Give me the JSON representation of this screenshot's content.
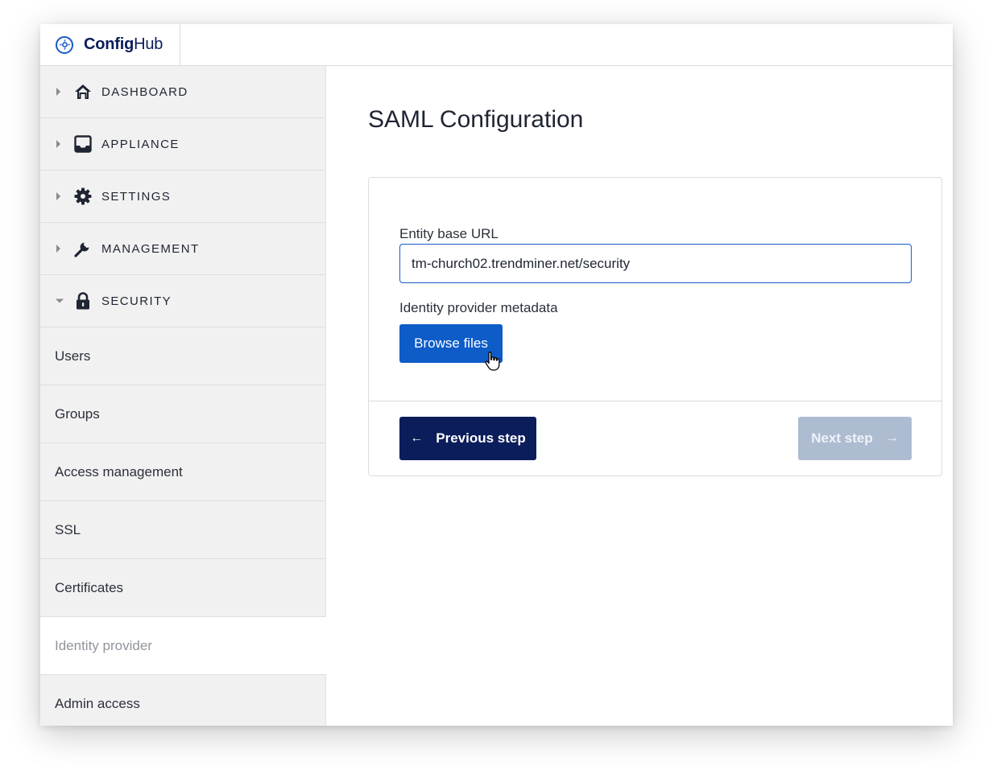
{
  "app": {
    "brand_bold": "Config",
    "brand_rest": "Hub",
    "brand_icon": "gear-circle-icon"
  },
  "sidebar": {
    "sections": [
      {
        "label": "DASHBOARD",
        "icon": "home-icon",
        "expanded": false
      },
      {
        "label": "APPLIANCE",
        "icon": "inbox-tray-icon",
        "expanded": false
      },
      {
        "label": "SETTINGS",
        "icon": "gear-icon",
        "expanded": false
      },
      {
        "label": "MANAGEMENT",
        "icon": "wrench-icon",
        "expanded": false
      },
      {
        "label": "SECURITY",
        "icon": "lock-icon",
        "expanded": true
      }
    ],
    "security_items": [
      {
        "label": "Users"
      },
      {
        "label": "Groups"
      },
      {
        "label": "Access management"
      },
      {
        "label": "SSL"
      },
      {
        "label": "Certificates"
      },
      {
        "label": "Identity provider",
        "active": true
      },
      {
        "label": "Admin access"
      }
    ]
  },
  "main": {
    "title": "SAML Configuration",
    "form": {
      "entity_label": "Entity base URL",
      "entity_value": "tm-church02.trendminer.net/security",
      "metadata_label": "Identity provider metadata",
      "browse_label": "Browse files"
    },
    "footer": {
      "previous_label": "Previous step",
      "next_label": "Next step",
      "next_disabled": true
    }
  },
  "colors": {
    "primary": "#0d5cc8",
    "navy": "#0b1d5a",
    "disabled": "#aebcd2",
    "sidebar_bg": "#f1f1f1"
  }
}
